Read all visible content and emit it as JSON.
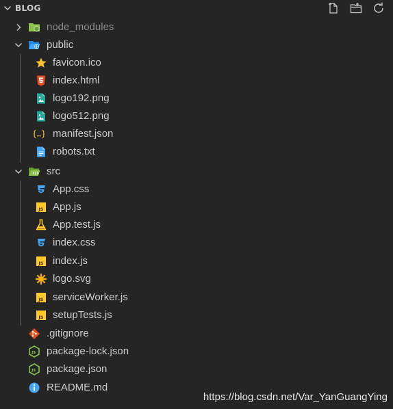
{
  "explorer": {
    "title": "BLOG",
    "header_icons": [
      "new-file-icon",
      "new-folder-icon",
      "refresh-icon"
    ]
  },
  "tree": {
    "node_modules": "node_modules",
    "public": "public",
    "public_files": [
      "favicon.ico",
      "index.html",
      "logo192.png",
      "logo512.png",
      "manifest.json",
      "robots.txt"
    ],
    "src": "src",
    "src_files": [
      "App.css",
      "App.js",
      "App.test.js",
      "index.css",
      "index.js",
      "logo.svg",
      "serviceWorker.js",
      "setupTests.js"
    ],
    "root_files": [
      ".gitignore",
      "package-lock.json",
      "package.json",
      "README.md"
    ]
  },
  "watermark": "https://blog.csdn.net/Var_YanGuangYing",
  "colors": {
    "background": "#252526",
    "text": "#cccccc",
    "folder_green": "#8bc34a",
    "folder_blue": "#42a5f5",
    "html_orange": "#e44d26",
    "image_teal": "#26a69a",
    "json_yellow": "#fbc02d",
    "css_blue": "#42a5f5",
    "js_yellow": "#ffca28",
    "git_orange": "#e64a19",
    "info_blue": "#42a5f5"
  }
}
